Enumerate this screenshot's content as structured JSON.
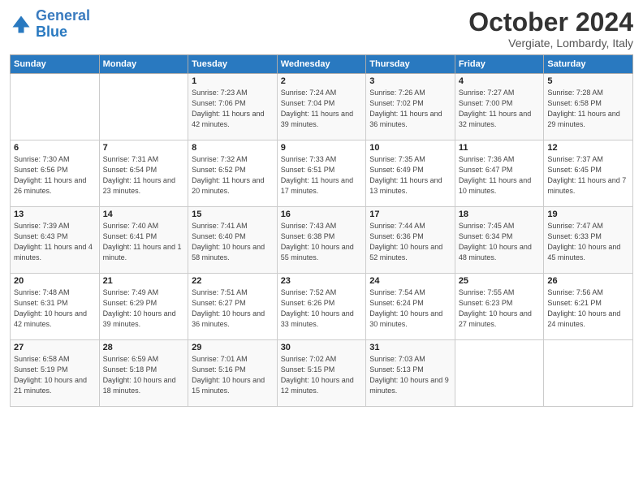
{
  "logo": {
    "line1": "General",
    "line2": "Blue"
  },
  "title": "October 2024",
  "location": "Vergiate, Lombardy, Italy",
  "headers": [
    "Sunday",
    "Monday",
    "Tuesday",
    "Wednesday",
    "Thursday",
    "Friday",
    "Saturday"
  ],
  "weeks": [
    [
      {
        "day": "",
        "content": ""
      },
      {
        "day": "",
        "content": ""
      },
      {
        "day": "1",
        "content": "Sunrise: 7:23 AM\nSunset: 7:06 PM\nDaylight: 11 hours and 42 minutes."
      },
      {
        "day": "2",
        "content": "Sunrise: 7:24 AM\nSunset: 7:04 PM\nDaylight: 11 hours and 39 minutes."
      },
      {
        "day": "3",
        "content": "Sunrise: 7:26 AM\nSunset: 7:02 PM\nDaylight: 11 hours and 36 minutes."
      },
      {
        "day": "4",
        "content": "Sunrise: 7:27 AM\nSunset: 7:00 PM\nDaylight: 11 hours and 32 minutes."
      },
      {
        "day": "5",
        "content": "Sunrise: 7:28 AM\nSunset: 6:58 PM\nDaylight: 11 hours and 29 minutes."
      }
    ],
    [
      {
        "day": "6",
        "content": "Sunrise: 7:30 AM\nSunset: 6:56 PM\nDaylight: 11 hours and 26 minutes."
      },
      {
        "day": "7",
        "content": "Sunrise: 7:31 AM\nSunset: 6:54 PM\nDaylight: 11 hours and 23 minutes."
      },
      {
        "day": "8",
        "content": "Sunrise: 7:32 AM\nSunset: 6:52 PM\nDaylight: 11 hours and 20 minutes."
      },
      {
        "day": "9",
        "content": "Sunrise: 7:33 AM\nSunset: 6:51 PM\nDaylight: 11 hours and 17 minutes."
      },
      {
        "day": "10",
        "content": "Sunrise: 7:35 AM\nSunset: 6:49 PM\nDaylight: 11 hours and 13 minutes."
      },
      {
        "day": "11",
        "content": "Sunrise: 7:36 AM\nSunset: 6:47 PM\nDaylight: 11 hours and 10 minutes."
      },
      {
        "day": "12",
        "content": "Sunrise: 7:37 AM\nSunset: 6:45 PM\nDaylight: 11 hours and 7 minutes."
      }
    ],
    [
      {
        "day": "13",
        "content": "Sunrise: 7:39 AM\nSunset: 6:43 PM\nDaylight: 11 hours and 4 minutes."
      },
      {
        "day": "14",
        "content": "Sunrise: 7:40 AM\nSunset: 6:41 PM\nDaylight: 11 hours and 1 minute."
      },
      {
        "day": "15",
        "content": "Sunrise: 7:41 AM\nSunset: 6:40 PM\nDaylight: 10 hours and 58 minutes."
      },
      {
        "day": "16",
        "content": "Sunrise: 7:43 AM\nSunset: 6:38 PM\nDaylight: 10 hours and 55 minutes."
      },
      {
        "day": "17",
        "content": "Sunrise: 7:44 AM\nSunset: 6:36 PM\nDaylight: 10 hours and 52 minutes."
      },
      {
        "day": "18",
        "content": "Sunrise: 7:45 AM\nSunset: 6:34 PM\nDaylight: 10 hours and 48 minutes."
      },
      {
        "day": "19",
        "content": "Sunrise: 7:47 AM\nSunset: 6:33 PM\nDaylight: 10 hours and 45 minutes."
      }
    ],
    [
      {
        "day": "20",
        "content": "Sunrise: 7:48 AM\nSunset: 6:31 PM\nDaylight: 10 hours and 42 minutes."
      },
      {
        "day": "21",
        "content": "Sunrise: 7:49 AM\nSunset: 6:29 PM\nDaylight: 10 hours and 39 minutes."
      },
      {
        "day": "22",
        "content": "Sunrise: 7:51 AM\nSunset: 6:27 PM\nDaylight: 10 hours and 36 minutes."
      },
      {
        "day": "23",
        "content": "Sunrise: 7:52 AM\nSunset: 6:26 PM\nDaylight: 10 hours and 33 minutes."
      },
      {
        "day": "24",
        "content": "Sunrise: 7:54 AM\nSunset: 6:24 PM\nDaylight: 10 hours and 30 minutes."
      },
      {
        "day": "25",
        "content": "Sunrise: 7:55 AM\nSunset: 6:23 PM\nDaylight: 10 hours and 27 minutes."
      },
      {
        "day": "26",
        "content": "Sunrise: 7:56 AM\nSunset: 6:21 PM\nDaylight: 10 hours and 24 minutes."
      }
    ],
    [
      {
        "day": "27",
        "content": "Sunrise: 6:58 AM\nSunset: 5:19 PM\nDaylight: 10 hours and 21 minutes."
      },
      {
        "day": "28",
        "content": "Sunrise: 6:59 AM\nSunset: 5:18 PM\nDaylight: 10 hours and 18 minutes."
      },
      {
        "day": "29",
        "content": "Sunrise: 7:01 AM\nSunset: 5:16 PM\nDaylight: 10 hours and 15 minutes."
      },
      {
        "day": "30",
        "content": "Sunrise: 7:02 AM\nSunset: 5:15 PM\nDaylight: 10 hours and 12 minutes."
      },
      {
        "day": "31",
        "content": "Sunrise: 7:03 AM\nSunset: 5:13 PM\nDaylight: 10 hours and 9 minutes."
      },
      {
        "day": "",
        "content": ""
      },
      {
        "day": "",
        "content": ""
      }
    ]
  ]
}
